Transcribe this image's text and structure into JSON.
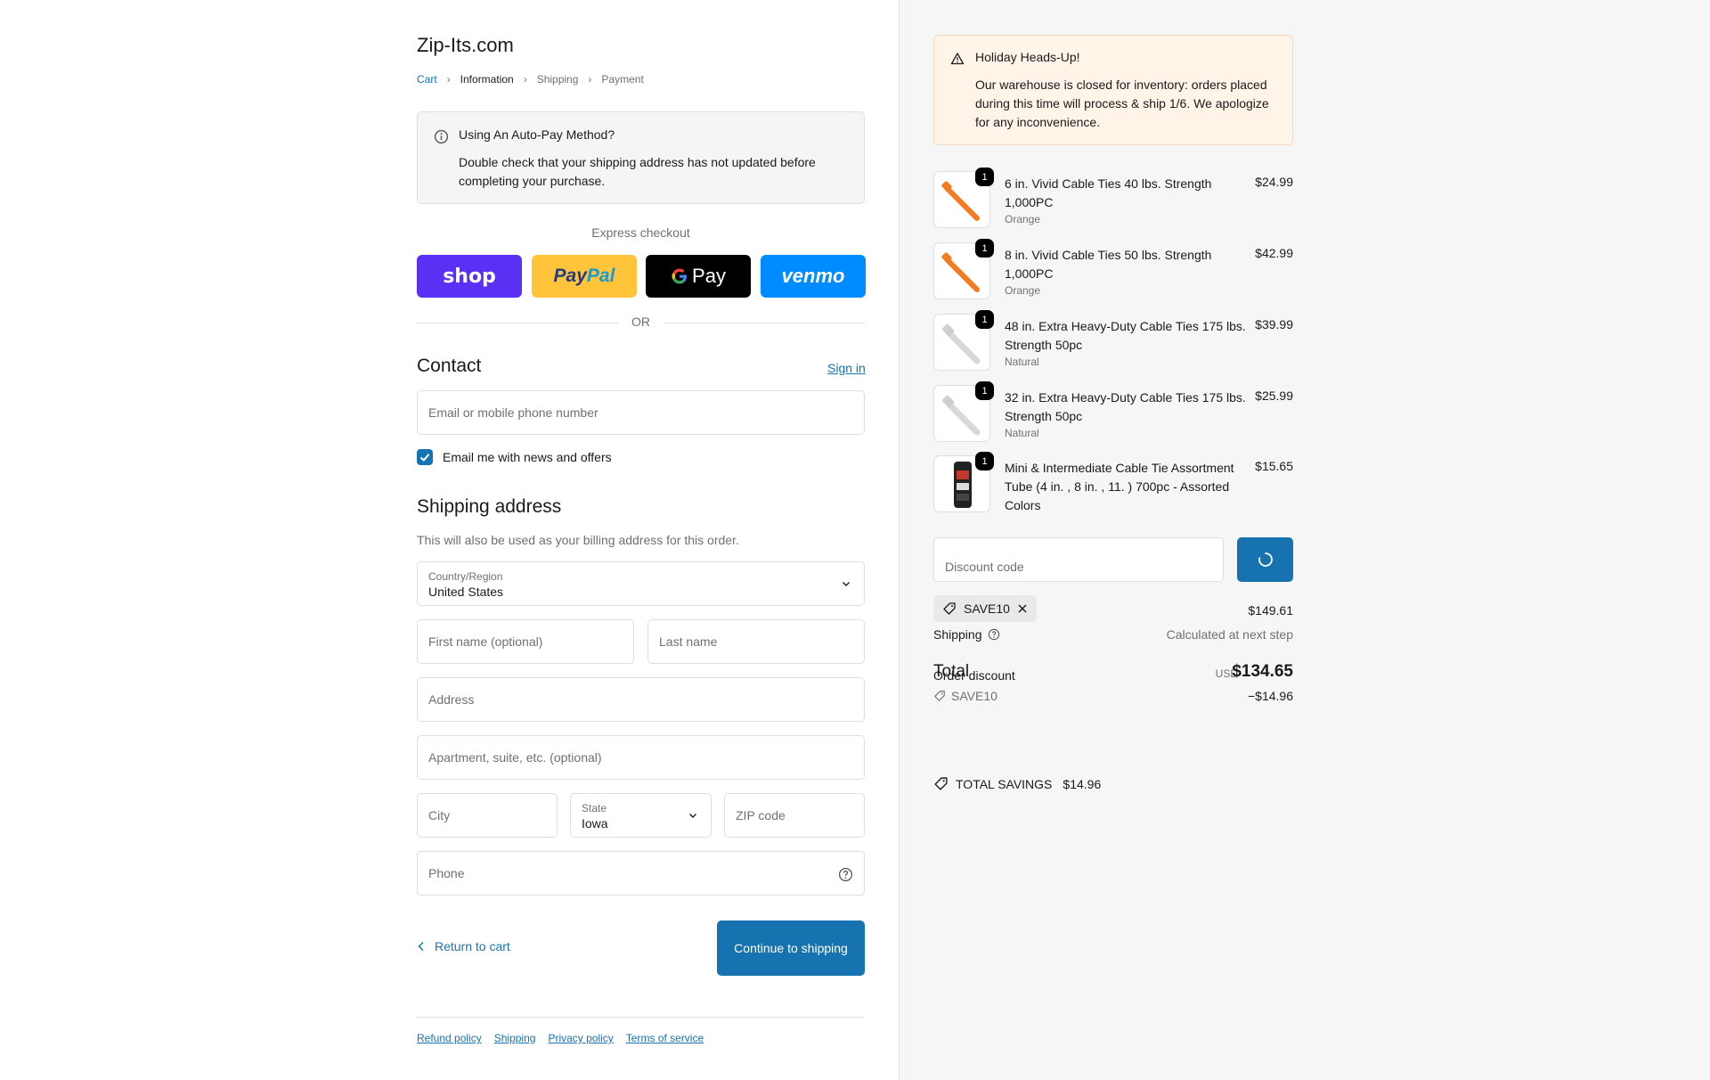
{
  "store": {
    "name": "Zip-Its.com"
  },
  "breadcrumb": [
    {
      "label": "Cart"
    },
    {
      "label": "Information"
    },
    {
      "label": "Shipping"
    },
    {
      "label": "Payment"
    }
  ],
  "autopay_notice": {
    "title": "Using An Auto-Pay Method?",
    "body": "Double check that your shipping address has not updated before completing your purchase."
  },
  "express": {
    "label": "Express checkout",
    "buttons": [
      {
        "name": "shop",
        "label": "shop"
      },
      {
        "name": "paypal",
        "label_a": "Pay",
        "label_b": "Pal"
      },
      {
        "name": "gpay",
        "label": "Pay"
      },
      {
        "name": "venmo",
        "label": "venmo"
      }
    ],
    "separator": "OR"
  },
  "contact": {
    "heading": "Contact",
    "sign_in": "Sign in",
    "email_placeholder": "Email or mobile phone number",
    "newsletter_label": "Email me with news and offers"
  },
  "shipping_address": {
    "heading": "Shipping address",
    "subtext": "This will also be used as your billing address for this order.",
    "country_label": "Country/Region",
    "country_value": "United States",
    "first_name_placeholder": "First name (optional)",
    "last_name_placeholder": "Last name",
    "address_placeholder": "Address",
    "apartment_placeholder": "Apartment, suite, etc. (optional)",
    "city_placeholder": "City",
    "state_label": "State",
    "state_value": "Iowa",
    "zip_placeholder": "ZIP code",
    "phone_placeholder": "Phone"
  },
  "actions": {
    "return_label": "Return to cart",
    "continue_label": "Continue to shipping"
  },
  "footer_links": [
    "Refund policy",
    "Shipping",
    "Privacy policy",
    "Terms of service"
  ],
  "holiday_notice": {
    "title": "Holiday Heads-Up!",
    "body": "Our warehouse is closed for inventory: orders placed during this time will process & ship 1/6. We apologize for any inconvenience."
  },
  "cart_items": [
    {
      "qty": "1",
      "name": "6 in. Vivid Cable Ties 40 lbs. Strength 1,000PC",
      "variant": "Orange",
      "price": "$24.99",
      "thumb": "orange-tie"
    },
    {
      "qty": "1",
      "name": "8 in. Vivid Cable Ties 50 lbs. Strength 1,000PC",
      "variant": "Orange",
      "price": "$42.99",
      "thumb": "orange-tie"
    },
    {
      "qty": "1",
      "name": "48 in. Extra Heavy-Duty Cable Ties 175 lbs. Strength 50pc",
      "variant": "Natural",
      "price": "$39.99",
      "thumb": "natural-tie"
    },
    {
      "qty": "1",
      "name": "32 in. Extra Heavy-Duty Cable Ties 175 lbs. Strength 50pc",
      "variant": "Natural",
      "price": "$25.99",
      "thumb": "natural-tie"
    },
    {
      "qty": "1",
      "name": "Mini & Intermediate Cable Tie Assortment Tube (4 in. , 8 in. , 11. ) 700pc - Assorted Colors",
      "variant": "",
      "price": "$15.65",
      "thumb": "tube"
    }
  ],
  "discount": {
    "placeholder": "Discount code",
    "applied_code": "SAVE10"
  },
  "totals": {
    "subtotal": "$149.61",
    "shipping_label": "Shipping",
    "shipping_value": "Calculated at next step",
    "total_label": "Total",
    "currency": "USD",
    "total_value": "$134.65",
    "order_discount_label": "Order discount",
    "order_discount_code": "SAVE10",
    "order_discount_amount": "−$14.96",
    "savings_label": "TOTAL SAVINGS",
    "savings_value": "$14.96"
  },
  "colors": {
    "accent": "#1773b0",
    "shop_pay": "#5a31f4",
    "paypal": "#ffc439",
    "venmo": "#008cff",
    "notice_bg": "#fff4e8"
  }
}
